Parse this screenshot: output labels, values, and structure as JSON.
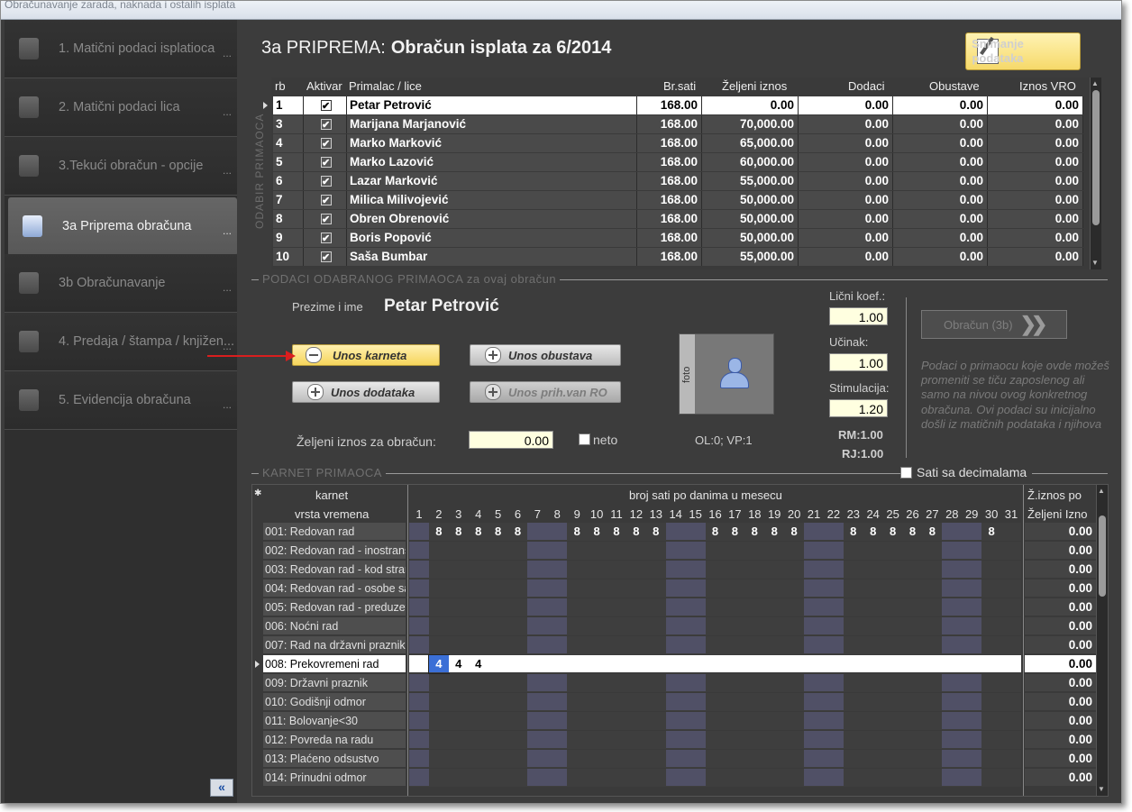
{
  "window": {
    "title": "Obračunavanje zarada, naknada i ostalih isplata"
  },
  "sidebar": {
    "items": [
      {
        "label": "1. Matični podaci isplatioca",
        "dots": "...",
        "icon": "column-icon"
      },
      {
        "label": "2. Matični podaci lica",
        "dots": "...",
        "icon": "person-icon"
      },
      {
        "label": "3.Tekući obračun - opcije",
        "dots": "...",
        "icon": "database-check-icon"
      },
      {
        "label": "3a Priprema obračuna",
        "dots": "...",
        "icon": "list-database-icon",
        "active": true
      },
      {
        "label": "3b Obračunavanje",
        "dots": "...",
        "icon": "database-gear-icon"
      },
      {
        "label": "4. Predaja / štampa / knjižen...",
        "dots": "...",
        "icon": "database-info-icon"
      },
      {
        "label": "5. Evidencija obračuna",
        "dots": "...",
        "icon": "database-icon"
      }
    ],
    "collapse_label": "«"
  },
  "header": {
    "prefix": "3a PRIPREMA:",
    "title": "Obračun isplata za 6/2014",
    "save_button": "Snimanje podataka"
  },
  "recipients": {
    "side_label": "ODABIR PRIMAOCA",
    "columns": [
      "rb",
      "Aktivar",
      "Primalac / lice",
      "Br.sati",
      "Željeni iznos",
      "Dodaci",
      "Obustave",
      "Iznos VRO"
    ],
    "rows": [
      {
        "rb": "1",
        "name": "Petar Petrović",
        "sati": "168.00",
        "iznos": "0.00",
        "dodaci": "0.00",
        "obustave": "0.00",
        "vro": "0.00",
        "selected": true
      },
      {
        "rb": "3",
        "name": "Marijana Marjanović",
        "sati": "168.00",
        "iznos": "70,000.00",
        "dodaci": "0.00",
        "obustave": "0.00",
        "vro": "0.00"
      },
      {
        "rb": "4",
        "name": "Marko Marković",
        "sati": "168.00",
        "iznos": "65,000.00",
        "dodaci": "0.00",
        "obustave": "0.00",
        "vro": "0.00"
      },
      {
        "rb": "5",
        "name": "Marko Lazović",
        "sati": "168.00",
        "iznos": "60,000.00",
        "dodaci": "0.00",
        "obustave": "0.00",
        "vro": "0.00"
      },
      {
        "rb": "6",
        "name": "Lazar Marković",
        "sati": "168.00",
        "iznos": "55,000.00",
        "dodaci": "0.00",
        "obustave": "0.00",
        "vro": "0.00"
      },
      {
        "rb": "7",
        "name": "Milica Milivojević",
        "sati": "168.00",
        "iznos": "50,000.00",
        "dodaci": "0.00",
        "obustave": "0.00",
        "vro": "0.00"
      },
      {
        "rb": "8",
        "name": "Obren Obrenović",
        "sati": "168.00",
        "iznos": "50,000.00",
        "dodaci": "0.00",
        "obustave": "0.00",
        "vro": "0.00"
      },
      {
        "rb": "9",
        "name": "Boris Popović",
        "sati": "168.00",
        "iznos": "50,000.00",
        "dodaci": "0.00",
        "obustave": "0.00",
        "vro": "0.00"
      },
      {
        "rb": "10",
        "name": "Saša Bumbar",
        "sati": "168.00",
        "iznos": "55,000.00",
        "dodaci": "0.00",
        "obustave": "0.00",
        "vro": "0.00"
      }
    ]
  },
  "details": {
    "section_label": "PODACI ODABRANOG PRIMAOCA za ovaj obračun",
    "name_label": "Prezime i ime",
    "name_value": "Petar Petrović",
    "btn_karnet": "Unos karneta",
    "btn_obustava": "Unos obustava",
    "btn_dodataka": "Unos dodataka",
    "btn_prih": "Unos prih.van RO",
    "zeljeni_label": "Željeni iznos za obračun:",
    "zeljeni_value": "0.00",
    "neto_label": "neto",
    "foto_label": "foto",
    "ol_vp": "OL:0;  VP:1",
    "licni_label": "Lični koef.:",
    "licni_value": "1.00",
    "ucinak_label": "Učinak:",
    "ucinak_value": "1.00",
    "stim_label": "Stimulacija:",
    "stim_value": "1.20",
    "rm": "RM:1.00",
    "rj": "RJ:1.00",
    "obracun_btn": "Obračun (3b)",
    "info": "Podaci o primaocu koje ovde možeš promeniti se tiču zaposlenog ali samo na nivou ovog konkretnog obračuna. Ovi podaci su inicijalno došli iz matičnih podataka i njihova"
  },
  "karnet": {
    "section_label": "KARNET PRIMAOCA",
    "sati_decimal_label": "Sati sa decimalama",
    "col_karnet": "karnet",
    "col_vrsta": "vrsta vremena",
    "col_broj": "broj sati po danima u mesecu",
    "col_ziznos": "Ž.iznos po",
    "col_zeljeni": "Željeni Izno",
    "star": "✱",
    "days": [
      "1",
      "2",
      "3",
      "4",
      "5",
      "6",
      "7",
      "8",
      "9",
      "10",
      "11",
      "12",
      "13",
      "14",
      "15",
      "16",
      "17",
      "18",
      "19",
      "20",
      "21",
      "22",
      "23",
      "24",
      "25",
      "26",
      "27",
      "28",
      "29",
      "30",
      "31"
    ],
    "rows": [
      {
        "name": "001: Redovan rad",
        "hours": {
          "2": "8",
          "3": "8",
          "4": "8",
          "5": "8",
          "6": "8",
          "9": "8",
          "10": "8",
          "11": "8",
          "12": "8",
          "13": "8",
          "16": "8",
          "17": "8",
          "18": "8",
          "19": "8",
          "20": "8",
          "23": "8",
          "24": "8",
          "25": "8",
          "26": "8",
          "27": "8",
          "30": "8"
        },
        "amt": "0.00"
      },
      {
        "name": "002: Redovan rad - inostrans",
        "hours": {},
        "amt": "0.00"
      },
      {
        "name": "003: Redovan rad - kod stran",
        "hours": {},
        "amt": "0.00"
      },
      {
        "name": "004: Redovan rad - osobe sa",
        "hours": {},
        "amt": "0.00"
      },
      {
        "name": "005: Redovan rad - preduzet",
        "hours": {},
        "amt": "0.00"
      },
      {
        "name": "006: Noćni rad",
        "hours": {},
        "amt": "0.00"
      },
      {
        "name": "007: Rad na državni praznik",
        "hours": {},
        "amt": "0.00"
      },
      {
        "name": "008: Prekovremeni rad",
        "hours": {
          "2": "4",
          "3": "4",
          "4": "4"
        },
        "amt": "0.00",
        "selected": true
      },
      {
        "name": "009: Državni praznik",
        "hours": {},
        "amt": "0.00"
      },
      {
        "name": "010: Godišnji odmor",
        "hours": {},
        "amt": "0.00"
      },
      {
        "name": "011: Bolovanje<30",
        "hours": {},
        "amt": "0.00"
      },
      {
        "name": "012: Povreda na radu",
        "hours": {},
        "amt": "0.00"
      },
      {
        "name": "013: Plaćeno odsustvo",
        "hours": {},
        "amt": "0.00"
      },
      {
        "name": "014: Prinudni odmor",
        "hours": {},
        "amt": "0.00"
      }
    ],
    "weekend_days": [
      1,
      7,
      8,
      14,
      15,
      21,
      22,
      28,
      29
    ]
  }
}
